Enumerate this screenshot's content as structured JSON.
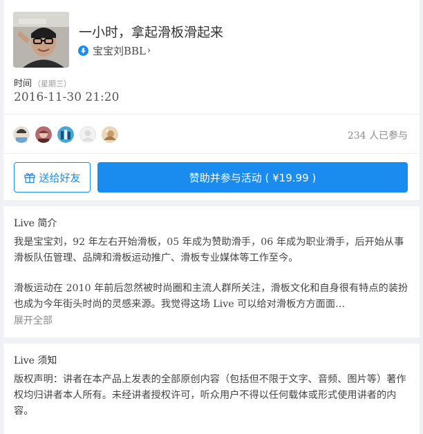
{
  "live": {
    "title": "一小时，拿起滑板滑起来",
    "speaker": "宝宝刘BBL",
    "speaker_chevron": "›",
    "time_label": "时间",
    "weekday": "（星期三）",
    "datetime": "2016-11-30 21:20"
  },
  "participants": {
    "count_text": "234 人已参与",
    "avatars": [
      "participant-avatar",
      "participant-avatar",
      "participant-avatar",
      "participant-avatar",
      "participant-avatar"
    ]
  },
  "actions": {
    "gift_label": "送给好友",
    "join_label": "赞助并参与活动 ( ¥19.99 )"
  },
  "intro": {
    "heading": "Live 简介",
    "paragraph1": "我是宝宝刘，92 年左右开始滑板，05 年成为赞助滑手，06 年成为职业滑手，后开始从事滑板队伍管理、品牌和滑板运动推广、滑板专业媒体等工作至今。",
    "paragraph2": "滑板运动在 2010 年前后忽然被时尚圈和主流人群所关注，滑板文化和自身很有特点的装扮也成为今年街头时尚的灵感来源。我觉得这场 Live 可以给对滑板方方面面…",
    "expand_label": "展开全部"
  },
  "notice": {
    "heading": "Live 须知",
    "text": "版权声明：讲者在本产品上发表的全部原创内容（包括但不限于文字、音频、图片等）著作权均归讲者本人所有。未经讲者授权许可，听众用户不得以任何载体或形式使用讲者的内容。"
  },
  "colors": {
    "accent": "#1a8cf0",
    "page_bg": "#f0f1f4",
    "card_bg": "#ffffff",
    "muted_text": "#8a8a8a"
  },
  "icons": {
    "mic": "microphone-icon",
    "gift": "gift-icon",
    "chevron": "chevron-right-icon"
  }
}
